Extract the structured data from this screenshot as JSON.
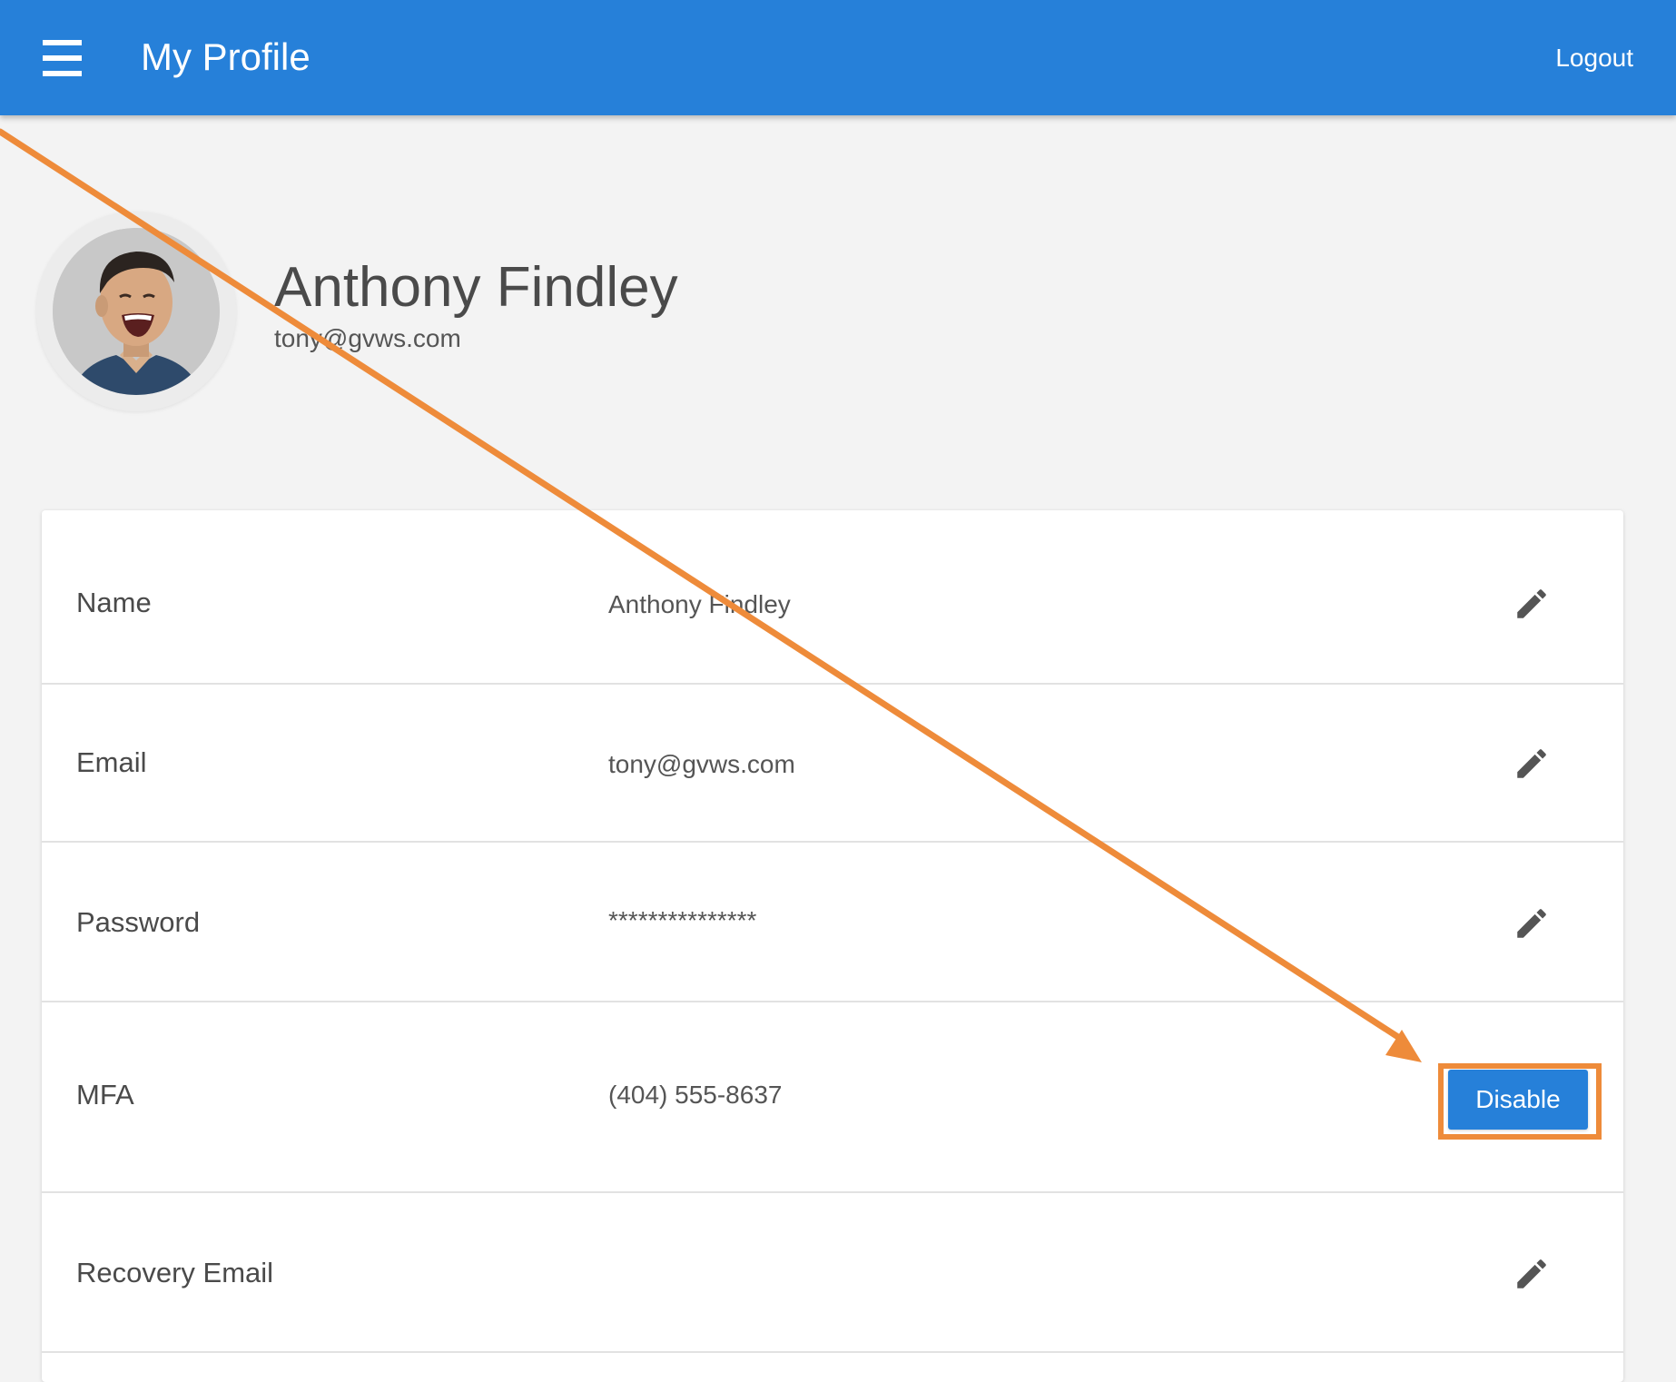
{
  "header": {
    "title": "My Profile",
    "logout_label": "Logout",
    "background_color": "#2680d9"
  },
  "profile": {
    "name": "Anthony Findley",
    "email": "tony@gvws.com"
  },
  "rows": [
    {
      "label": "Name",
      "value": "Anthony Findley",
      "action": "pencil-icon"
    },
    {
      "label": "Email",
      "value": "tony@gvws.com",
      "action": "pencil-icon"
    },
    {
      "label": "Password",
      "value": "***************",
      "action": "pencil-icon"
    },
    {
      "label": "MFA",
      "value": "(404) 555-8637",
      "action_label": "Disable"
    },
    {
      "label": "Recovery Email",
      "value": "",
      "action": "pencil-icon"
    }
  ],
  "annotation": {
    "color": "#ee8b3a",
    "type": "arrow-to-highlight"
  }
}
